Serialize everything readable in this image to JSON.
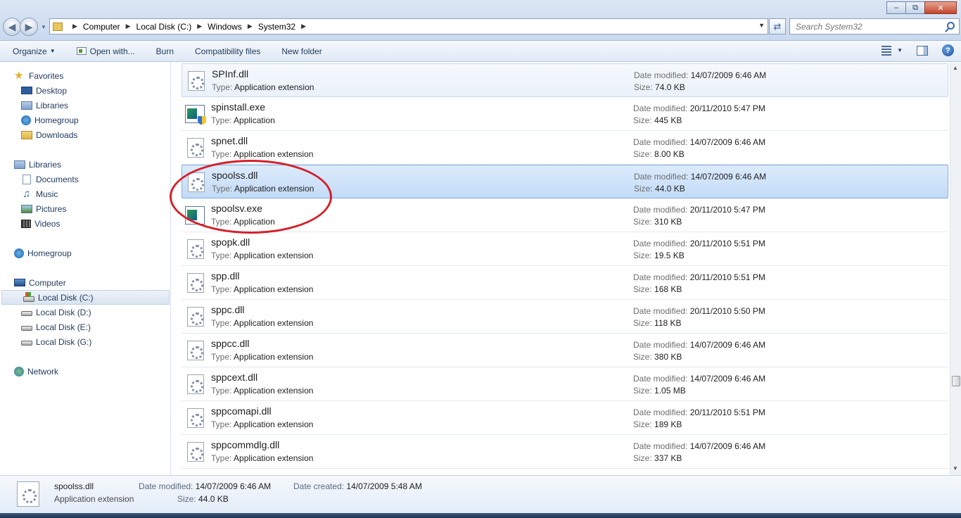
{
  "window": {
    "minimize_glyph": "–",
    "maximize_glyph": "⧉",
    "close_glyph": "✕"
  },
  "address": {
    "crumbs": [
      "Computer",
      "Local Disk (C:)",
      "Windows",
      "System32"
    ],
    "search_placeholder": "Search System32"
  },
  "toolbar": {
    "organize": "Organize",
    "open_with": "Open with...",
    "burn": "Burn",
    "compatibility": "Compatibility files",
    "new_folder": "New folder",
    "help": "?"
  },
  "sidebar": {
    "favorites": {
      "label": "Favorites",
      "items": [
        "Desktop",
        "Libraries",
        "Homegroup",
        "Downloads"
      ]
    },
    "libraries": {
      "label": "Libraries",
      "items": [
        "Documents",
        "Music",
        "Pictures",
        "Videos"
      ]
    },
    "homegroup": "Homegroup",
    "computer": {
      "label": "Computer",
      "items": [
        "Local Disk (C:)",
        "Local Disk (D:)",
        "Local Disk (E:)",
        "Local Disk (G:)"
      ]
    },
    "network": "Network"
  },
  "labels": {
    "type": "Type:",
    "date_modified": "Date modified:",
    "size": "Size:",
    "date_created": "Date created:"
  },
  "files": [
    {
      "name": "SPInf.dll",
      "type": "Application extension",
      "date": "14/07/2009 6:46 AM",
      "size": "74.0 KB",
      "icon": "dll-icon",
      "state": "hover"
    },
    {
      "name": "spinstall.exe",
      "type": "Application",
      "date": "20/11/2010 5:47 PM",
      "size": "445 KB",
      "icon": "exe-shield-icon",
      "state": "normal"
    },
    {
      "name": "spnet.dll",
      "type": "Application extension",
      "date": "14/07/2009 6:46 AM",
      "size": "8.00 KB",
      "icon": "dll-icon",
      "state": "normal"
    },
    {
      "name": "spoolss.dll",
      "type": "Application extension",
      "date": "14/07/2009 6:46 AM",
      "size": "44.0 KB",
      "icon": "dll-icon",
      "state": "selected"
    },
    {
      "name": "spoolsv.exe",
      "type": "Application",
      "date": "20/11/2010 5:47 PM",
      "size": "310 KB",
      "icon": "exe-icon",
      "state": "normal"
    },
    {
      "name": "spopk.dll",
      "type": "Application extension",
      "date": "20/11/2010 5:51 PM",
      "size": "19.5 KB",
      "icon": "dll-icon",
      "state": "normal"
    },
    {
      "name": "spp.dll",
      "type": "Application extension",
      "date": "20/11/2010 5:51 PM",
      "size": "168 KB",
      "icon": "dll-icon",
      "state": "normal"
    },
    {
      "name": "sppc.dll",
      "type": "Application extension",
      "date": "20/11/2010 5:50 PM",
      "size": "118 KB",
      "icon": "dll-icon",
      "state": "normal"
    },
    {
      "name": "sppcc.dll",
      "type": "Application extension",
      "date": "14/07/2009 6:46 AM",
      "size": "380 KB",
      "icon": "dll-icon",
      "state": "normal"
    },
    {
      "name": "sppcext.dll",
      "type": "Application extension",
      "date": "14/07/2009 6:46 AM",
      "size": "1.05 MB",
      "icon": "dll-icon",
      "state": "normal"
    },
    {
      "name": "sppcomapi.dll",
      "type": "Application extension",
      "date": "20/11/2010 5:51 PM",
      "size": "189 KB",
      "icon": "dll-icon",
      "state": "normal"
    },
    {
      "name": "sppcommdlg.dll",
      "type": "Application extension",
      "date": "14/07/2009 6:46 AM",
      "size": "337 KB",
      "icon": "dll-icon",
      "state": "normal"
    }
  ],
  "details": {
    "name": "spoolss.dll",
    "type": "Application extension",
    "date_modified": "14/07/2009 6:46 AM",
    "date_created": "14/07/2009 5:48 AM",
    "size": "44.0 KB"
  },
  "colors": {
    "selection": "#c3dbf6",
    "annotation": "#d5202a"
  }
}
